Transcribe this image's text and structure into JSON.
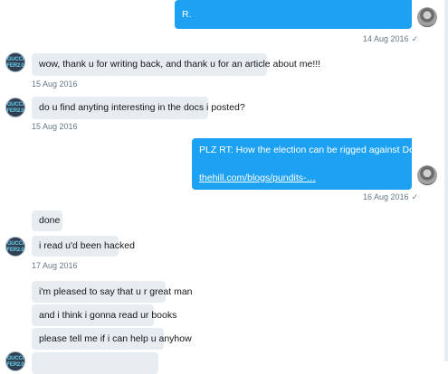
{
  "messages": [
    {
      "direction": "sent",
      "text": "R.",
      "time": "14 Aug 2016"
    },
    {
      "direction": "received",
      "text": "wow, thank u for writing back, and thank u for an article about me!!!",
      "time": "15 Aug 2016"
    },
    {
      "direction": "received",
      "text": "do u find anyting interesting in the docs i posted?",
      "time": "15 Aug 2016"
    },
    {
      "direction": "sent",
      "text": "PLZ RT: How the election can be rigged against Donald Trump",
      "link": "thehill.com/blogs/pundits-…",
      "time": "16 Aug 2016"
    },
    {
      "direction": "received",
      "text": "done"
    },
    {
      "direction": "received",
      "text": "i read u'd been hacked",
      "time": "17 Aug 2016"
    },
    {
      "direction": "received",
      "text": "i'm pleased to say that u r great man"
    },
    {
      "direction": "received",
      "text": "and i think i gonna read ur books"
    },
    {
      "direction": "received",
      "text": "please tell me if i can help u anyhow"
    }
  ],
  "avatar": {
    "line1": "GUCCI",
    "line2": "FER2.0"
  },
  "read_receipt_icon": "checkmark-icon"
}
